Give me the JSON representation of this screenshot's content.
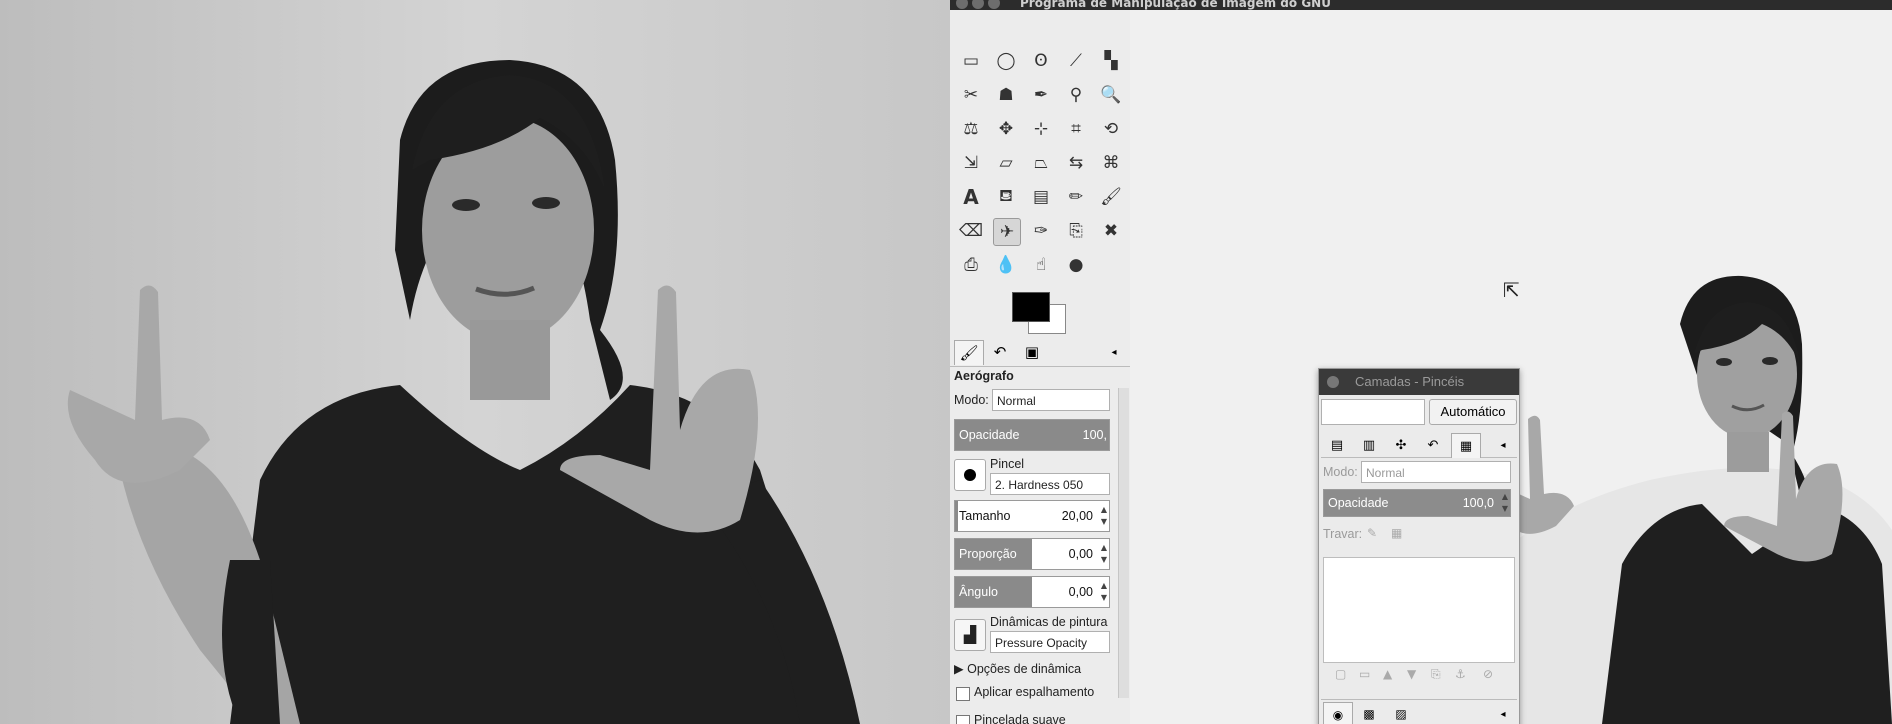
{
  "window": {
    "title": "Programa de Manipulação de Imagem do GNU"
  },
  "toolbox": {
    "tools": [
      {
        "name": "rect-select-icon",
        "glyph": "▭"
      },
      {
        "name": "ellipse-select-icon",
        "glyph": "◯"
      },
      {
        "name": "free-select-icon",
        "glyph": "ʘ"
      },
      {
        "name": "fuzzy-select-icon",
        "glyph": "⟋"
      },
      {
        "name": "select-by-color-icon",
        "glyph": "▚"
      },
      {
        "name": "scissors-icon",
        "glyph": "✂"
      },
      {
        "name": "foreground-select-icon",
        "glyph": "☗"
      },
      {
        "name": "paths-icon",
        "glyph": "✒"
      },
      {
        "name": "color-picker-icon",
        "glyph": "⚲"
      },
      {
        "name": "zoom-icon",
        "glyph": "🔍"
      },
      {
        "name": "measure-icon",
        "glyph": "⚖"
      },
      {
        "name": "move-icon",
        "glyph": "✥"
      },
      {
        "name": "align-icon",
        "glyph": "⊹"
      },
      {
        "name": "crop-icon",
        "glyph": "⌗"
      },
      {
        "name": "rotate-icon",
        "glyph": "⟲"
      },
      {
        "name": "scale-icon",
        "glyph": "⇲"
      },
      {
        "name": "shear-icon",
        "glyph": "▱"
      },
      {
        "name": "perspective-icon",
        "glyph": "⏢"
      },
      {
        "name": "flip-icon",
        "glyph": "⇆"
      },
      {
        "name": "cage-icon",
        "glyph": "⌘"
      },
      {
        "name": "text-icon",
        "glyph": "A"
      },
      {
        "name": "bucket-fill-icon",
        "glyph": "⛾"
      },
      {
        "name": "blend-icon",
        "glyph": "▤"
      },
      {
        "name": "pencil-icon",
        "glyph": "✏"
      },
      {
        "name": "paintbrush-icon",
        "glyph": "🖌"
      },
      {
        "name": "eraser-icon",
        "glyph": "⌫"
      },
      {
        "name": "airbrush-icon",
        "glyph": "✈"
      },
      {
        "name": "ink-icon",
        "glyph": "✑"
      },
      {
        "name": "clone-icon",
        "glyph": "⎘"
      },
      {
        "name": "heal-icon",
        "glyph": "✖"
      },
      {
        "name": "perspective-clone-icon",
        "glyph": "⎙"
      },
      {
        "name": "blur-icon",
        "glyph": "💧"
      },
      {
        "name": "smudge-icon",
        "glyph": "☝"
      },
      {
        "name": "dodge-burn-icon",
        "glyph": "●"
      }
    ],
    "active_tool": "airbrush-icon"
  },
  "tool_options": {
    "tool_name": "Aerógrafo",
    "mode_label": "Modo:",
    "mode_value": "Normal",
    "opacity": {
      "label": "Opacidade",
      "value": "100,",
      "fraction": 1.0
    },
    "brush_label": "Pincel",
    "brush_value": "2. Hardness 050",
    "size": {
      "label": "Tamanho",
      "value": "20,00",
      "fraction": 0.02
    },
    "aspect": {
      "label": "Proporção",
      "value": "0,00",
      "fraction": 0.5
    },
    "angle": {
      "label": "Ângulo",
      "value": "0,00",
      "fraction": 0.5
    },
    "dynamics_label": "Dinâmicas de pintura",
    "dynamics_value": "Pressure Opacity",
    "dynamics_options": "Opções de dinâmica",
    "apply_jitter": "Aplicar espalhamento",
    "smooth_stroke": "Pincelada suave"
  },
  "layers_dialog": {
    "title": "Camadas - Pincéis",
    "auto_button": "Automático",
    "mode_label": "Modo:",
    "mode_value": "Normal",
    "opacity_label": "Opacidade",
    "opacity_value": "100,0",
    "lock_label": "Travar:"
  }
}
